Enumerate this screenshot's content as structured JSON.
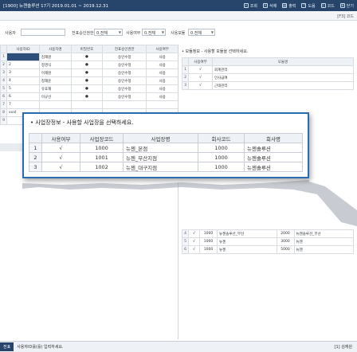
{
  "titlebar": {
    "title": "[1900] 뉴젠솔루션 17기 2019.01.01 ~ 2019.12.31",
    "buttons": [
      {
        "label": "조회",
        "icon": "search-icon"
      },
      {
        "label": "삭제",
        "icon": "delete-icon"
      },
      {
        "label": "출력",
        "icon": "print-icon"
      },
      {
        "label": "도움",
        "icon": "help-icon"
      },
      {
        "label": "코드",
        "icon": "code-icon"
      },
      {
        "label": "닫기",
        "icon": "close-icon"
      }
    ]
  },
  "subbar": {
    "code": "[F3] 코드"
  },
  "filter": {
    "user_label": "사용자",
    "user_value": "",
    "permission_label": "전표승인권한",
    "permission_value": "0.전체",
    "usage_label": "사용여부",
    "usage_value": "0.전체",
    "module_label": "사용모듈",
    "module_value": "0.전체"
  },
  "user_grid": {
    "headers": [
      "사용자ID",
      "사용자명",
      "비밀번호",
      "전표승인권한",
      "사용여부"
    ],
    "rows": [
      {
        "no": "1",
        "id": "",
        "name": "김재원",
        "pw": "●",
        "perm": "승인수정",
        "use": "사용"
      },
      {
        "no": "2",
        "id": "2",
        "name": "정경식",
        "pw": "●",
        "perm": "승인수정",
        "use": "사용"
      },
      {
        "no": "3",
        "id": "3",
        "name": "이재원",
        "pw": "●",
        "perm": "승인수정",
        "use": "사용"
      },
      {
        "no": "4",
        "id": "4",
        "name": "정재윤",
        "pw": "●",
        "perm": "승인수정",
        "use": "사용"
      },
      {
        "no": "5",
        "id": "5",
        "name": "유효재",
        "pw": "●",
        "perm": "승인수정",
        "use": "사용"
      },
      {
        "no": "6",
        "id": "6",
        "name": "이규선",
        "pw": "●",
        "perm": "승인수정",
        "use": "사용"
      },
      {
        "no": "7",
        "id": "7",
        "name": "",
        "pw": "",
        "perm": "",
        "use": ""
      },
      {
        "no": "8",
        "id": "xxxl",
        "name": "",
        "pw": "",
        "perm": "",
        "use": ""
      },
      {
        "no": "9",
        "id": "",
        "name": "",
        "pw": "",
        "perm": "",
        "use": ""
      }
    ]
  },
  "module_panel": {
    "title": "• 모듈정보 - 사용할 모듈을 선택하세요.",
    "headers": [
      "사용여부",
      "모듈명"
    ],
    "rows": [
      {
        "no": "1",
        "use": "√",
        "name": "회계관리"
      },
      {
        "no": "2",
        "use": "√",
        "name": "인사급여"
      },
      {
        "no": "3",
        "use": "√",
        "name": "근태관리"
      }
    ]
  },
  "biz_panel": {
    "title": "• 사업장정보 - 사용할 사업장을 선택하세요.",
    "headers": [
      "사용여부",
      "사업장코드",
      "사업장명",
      "회사코드",
      "회사명"
    ],
    "rows": [
      {
        "no": "1",
        "use": "√",
        "code": "1000",
        "name": "뉴젠_본점",
        "company_code": "1000",
        "company_name": "뉴젠솔루션"
      },
      {
        "no": "2",
        "use": "√",
        "code": "1001",
        "name": "뉴젠_부산지점",
        "company_code": "1000",
        "company_name": "뉴젠솔루션"
      },
      {
        "no": "3",
        "use": "√",
        "code": "1002",
        "name": "뉴젠_대구지점",
        "company_code": "1000",
        "company_name": "뉴젠솔루션"
      }
    ]
  },
  "lower_grid": {
    "rows": [
      {
        "no": "4",
        "use": "√",
        "code": "1000",
        "name": "뉴젠솔루션_부산",
        "company_code": "2000",
        "company_name": "뉴젠솔루션_부산"
      },
      {
        "no": "5",
        "use": "√",
        "code": "1000",
        "name": "뉴젠",
        "company_code": "3000",
        "company_name": "뉴젠"
      },
      {
        "no": "6",
        "use": "√",
        "code": "1000",
        "name": "뉴젠",
        "company_code": "5000",
        "company_name": "뉴젠"
      }
    ]
  },
  "statusbar": {
    "mode": "전표",
    "message": "사용자ID를(를) 입력하세요.",
    "user": "[1] 김재원"
  },
  "colors": {
    "titlebar": "#27456b",
    "accent": "#2b6cb0",
    "selected_cell": "#2e4f7a"
  }
}
